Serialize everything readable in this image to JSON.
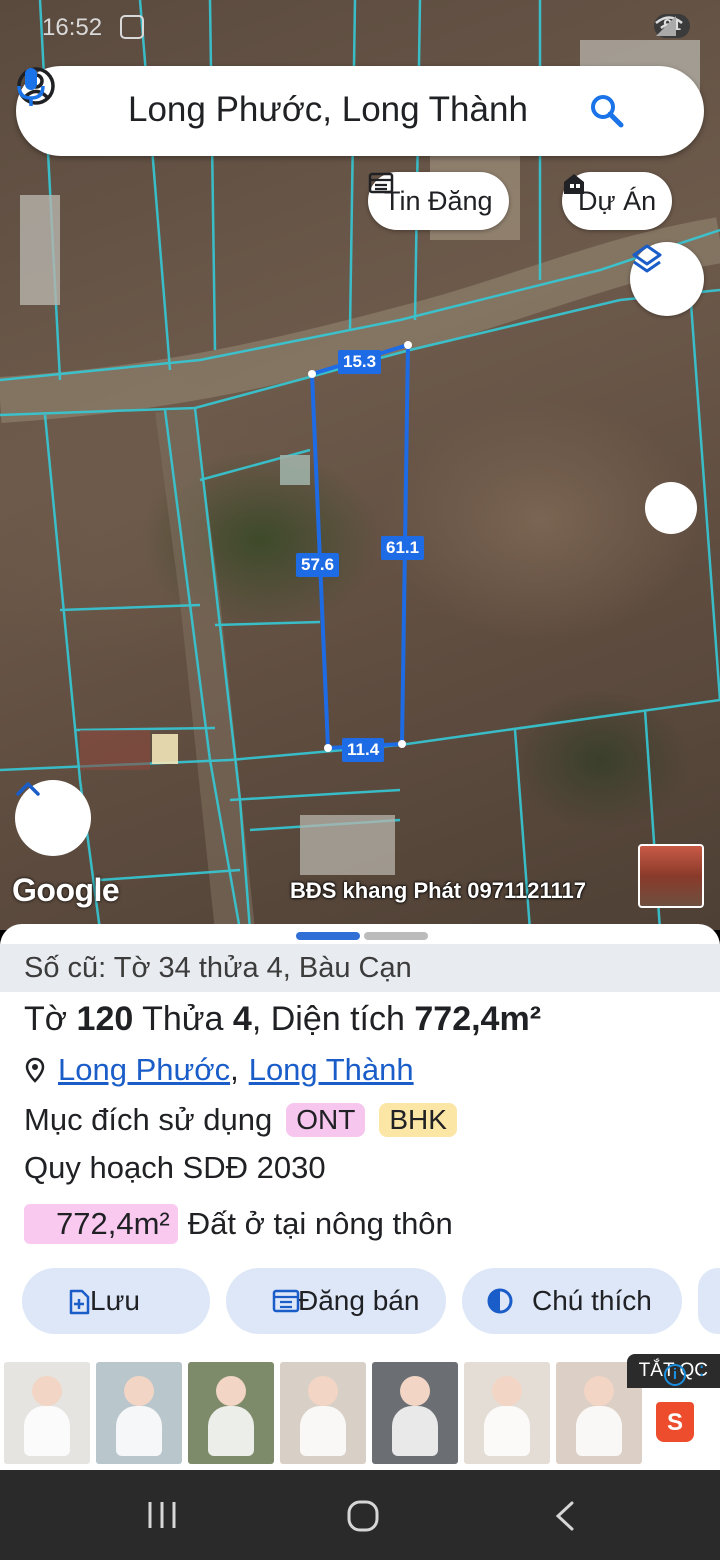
{
  "status": {
    "time": "16:52",
    "battery": "91"
  },
  "search": {
    "query": "Long Phước, Long Thành"
  },
  "map_chips": {
    "listings": "Tin Đăng",
    "projects": "Dự Án"
  },
  "parcel_dimensions": [
    "15.3",
    "61.1",
    "57.6",
    "11.4"
  ],
  "map_attribution": "Google",
  "map_watermark": "BĐS khang Phát 0971121117",
  "sheet": {
    "old_info": "Số cũ: Tờ 34 thửa 4, Bàu Cạn",
    "parcel": {
      "sheet_label": "Tờ",
      "sheet_no": "120",
      "plot_label": "Thửa",
      "plot_no": "4",
      "area_label": ", Diện tích",
      "area": "772,4m²"
    },
    "location": {
      "ward": "Long Phước",
      "separator": ",",
      "district": "Long Thành"
    },
    "purpose": {
      "label": "Mục đích sử dụng",
      "tags": [
        "ONT",
        "BHK"
      ]
    },
    "plan": "Quy hoạch SDĐ 2030",
    "area_row": {
      "value": "772,4m²",
      "description": "Đất ở tại nông thôn"
    },
    "actions": {
      "save": "Lưu",
      "post": "Đăng bán",
      "legend": "Chú thích"
    }
  },
  "ad": {
    "close_label": "TẮT QC",
    "shop_letter": "S"
  },
  "colors": {
    "accent": "#1a5dc9",
    "chip_bg": "#dde7f7",
    "ont_tag": "#f6c6ee",
    "bhk_tag": "#fbe6a6",
    "parcel_line": "#1e6be6"
  }
}
